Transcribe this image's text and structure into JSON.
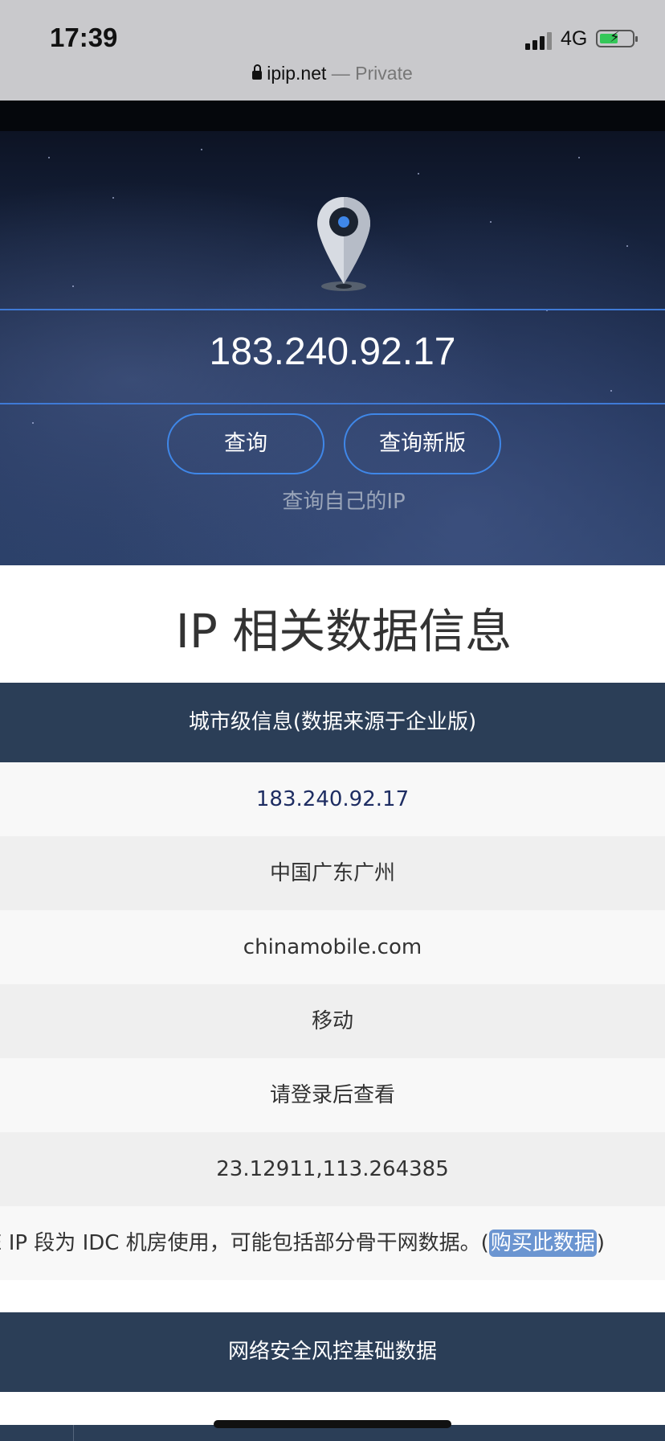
{
  "status_bar": {
    "time": "17:39",
    "network": "4G",
    "battery_level": 0.45,
    "battery_color": "#35c759",
    "signal_icon": "cellular-signal-icon",
    "battery_icon": "battery-charging-icon"
  },
  "browser": {
    "url": "ipip.net",
    "mode": "— Private",
    "lock_icon": "lock-icon"
  },
  "hero": {
    "pin_icon": "map-pin-icon",
    "ip_value": "183.240.92.17",
    "query_button": "查询",
    "query_new_button": "查询新版",
    "self_ip_link": "查询自己的IP",
    "accent_color": "#3f87e8"
  },
  "section_title": "IP 相关数据信息",
  "city_info": {
    "header": "城市级信息(数据来源于企业版)",
    "ip": "183.240.92.17",
    "location": "中国广东广州",
    "domain": "chinamobile.com",
    "isp": "移动",
    "login_required": "请登录后查看",
    "coordinates": "23.12911,113.264385",
    "note": "E IP 段为 IDC 机房使用，可能包括部分骨干网数据。(",
    "buy_link": "购买此数据",
    "note_end": ")"
  },
  "security": {
    "header": "网络安全风控基础数据"
  },
  "colors": {
    "header_bg": "#2b3e57",
    "link_highlight": "#6b95d1"
  }
}
